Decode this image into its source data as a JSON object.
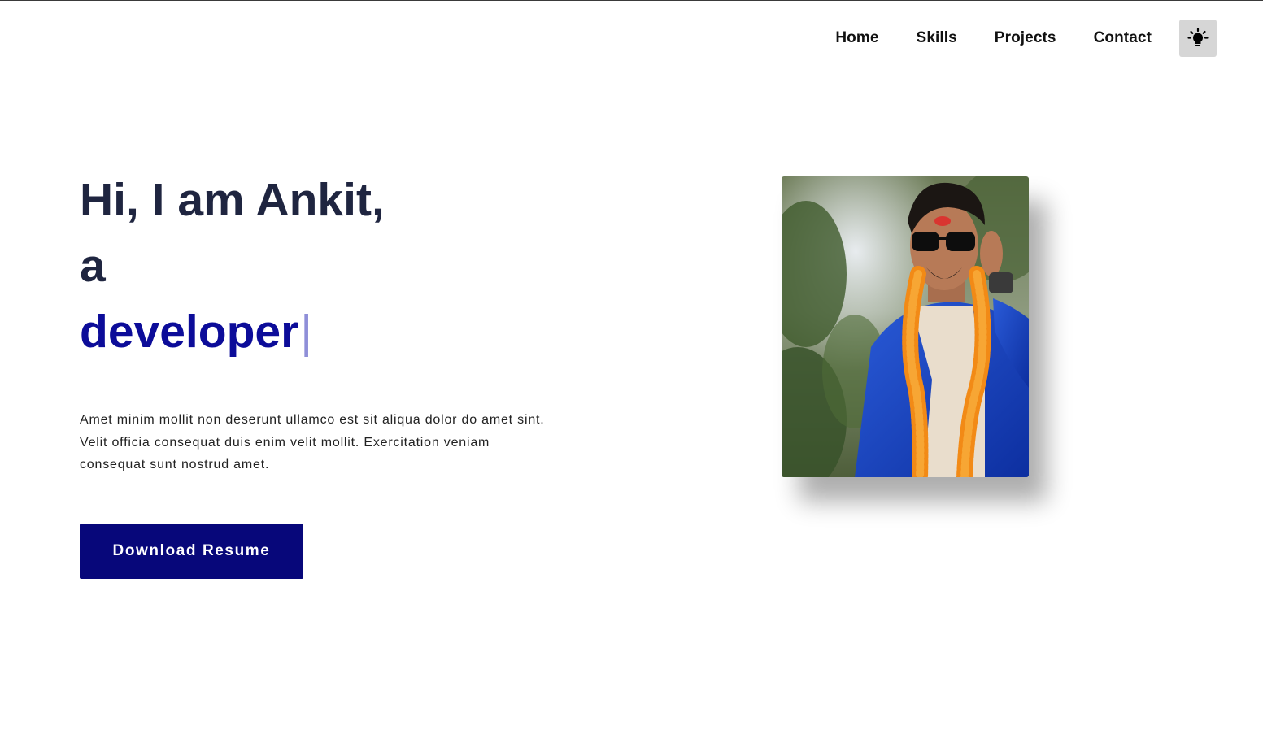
{
  "nav": {
    "items": [
      {
        "label": "Home"
      },
      {
        "label": "Skills"
      },
      {
        "label": "Projects"
      },
      {
        "label": "Contact"
      }
    ],
    "theme_toggle_icon": "lightbulb-icon"
  },
  "hero": {
    "greeting": "Hi, I am Ankit,",
    "article": "a",
    "role": "developer",
    "cursor": "|",
    "description": "Amet minim mollit non deserunt ullamco est sit aliqua dolor do amet sint. Velit officia consequat duis enim velit mollit. Exercitation veniam consequat sunt nostrud amet.",
    "button_label": "Download Resume"
  },
  "colors": {
    "heading": "#1f2540",
    "accent": "#0c0c99",
    "button": "#07077a",
    "toggle_bg": "#d6d6d6"
  }
}
